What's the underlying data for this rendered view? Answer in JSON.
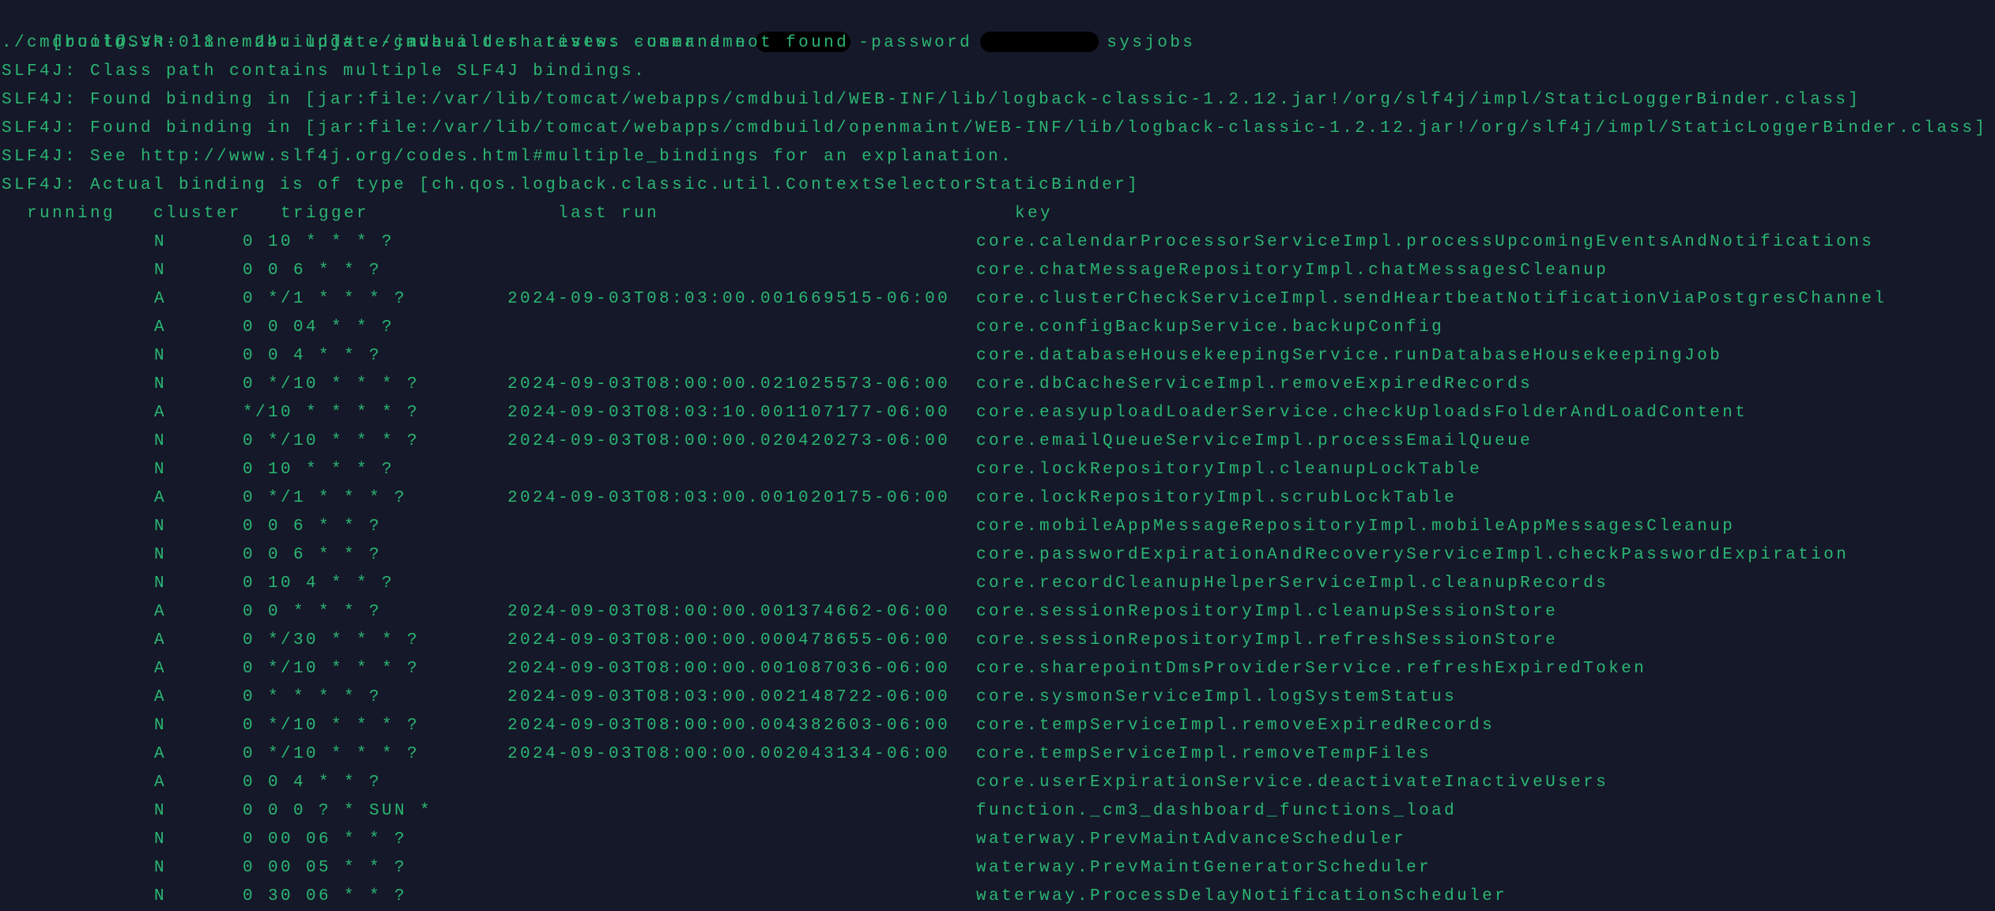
{
  "terminal": {
    "theme": {
      "background": "#151829",
      "foreground": "#2bb673"
    },
    "command": {
      "prompt": "[root@SVR-018 cmdbuild]#",
      "command_start": "./cmdbuild.sh restws -username",
      "username_redacted": true,
      "password_flag": "-password",
      "password_redacted": true,
      "argument": "sysjobs"
    },
    "output_lines": [
      "./cmdbuild.sh: line 24: update-java-alternatives: command not found",
      "SLF4J: Class path contains multiple SLF4J bindings.",
      "SLF4J: Found binding in [jar:file:/var/lib/tomcat/webapps/cmdbuild/WEB-INF/lib/logback-classic-1.2.12.jar!/org/slf4j/impl/StaticLoggerBinder.class]",
      "SLF4J: Found binding in [jar:file:/var/lib/tomcat/webapps/cmdbuild/openmaint/WEB-INF/lib/logback-classic-1.2.12.jar!/org/slf4j/impl/StaticLoggerBinder.class]",
      "SLF4J: See http://www.slf4j.org/codes.html#multiple_bindings for an explanation.",
      "SLF4J: Actual binding is of type [ch.qos.logback.classic.util.ContextSelectorStaticBinder]"
    ],
    "jobs_table": {
      "headers": {
        "running": "running",
        "cluster": "cluster",
        "trigger": "trigger",
        "last_run": "last run",
        "key": "key"
      },
      "rows": [
        {
          "running": "",
          "cluster": "N",
          "trigger": "0 10 * * * ?",
          "last_run": "",
          "key": "core.calendarProcessorServiceImpl.processUpcomingEventsAndNotifications"
        },
        {
          "running": "",
          "cluster": "N",
          "trigger": "0 0 6 * * ?",
          "last_run": "",
          "key": "core.chatMessageRepositoryImpl.chatMessagesCleanup"
        },
        {
          "running": "",
          "cluster": "A",
          "trigger": "0 */1 * * * ?",
          "last_run": "2024-09-03T08:03:00.001669515-06:00",
          "key": "core.clusterCheckServiceImpl.sendHeartbeatNotificationViaPostgresChannel"
        },
        {
          "running": "",
          "cluster": "A",
          "trigger": "0 0 04 * * ?",
          "last_run": "",
          "key": "core.configBackupService.backupConfig"
        },
        {
          "running": "",
          "cluster": "N",
          "trigger": "0 0 4 * * ?",
          "last_run": "",
          "key": "core.databaseHousekeepingService.runDatabaseHousekeepingJob"
        },
        {
          "running": "",
          "cluster": "N",
          "trigger": "0 */10 * * * ?",
          "last_run": "2024-09-03T08:00:00.021025573-06:00",
          "key": "core.dbCacheServiceImpl.removeExpiredRecords"
        },
        {
          "running": "",
          "cluster": "A",
          "trigger": "*/10 * * * * ?",
          "last_run": "2024-09-03T08:03:10.001107177-06:00",
          "key": "core.easyuploadLoaderService.checkUploadsFolderAndLoadContent"
        },
        {
          "running": "",
          "cluster": "N",
          "trigger": "0 */10 * * * ?",
          "last_run": "2024-09-03T08:00:00.020420273-06:00",
          "key": "core.emailQueueServiceImpl.processEmailQueue"
        },
        {
          "running": "",
          "cluster": "N",
          "trigger": "0 10 * * * ?",
          "last_run": "",
          "key": "core.lockRepositoryImpl.cleanupLockTable"
        },
        {
          "running": "",
          "cluster": "A",
          "trigger": "0 */1 * * * ?",
          "last_run": "2024-09-03T08:03:00.001020175-06:00",
          "key": "core.lockRepositoryImpl.scrubLockTable"
        },
        {
          "running": "",
          "cluster": "N",
          "trigger": "0 0 6 * * ?",
          "last_run": "",
          "key": "core.mobileAppMessageRepositoryImpl.mobileAppMessagesCleanup"
        },
        {
          "running": "",
          "cluster": "N",
          "trigger": "0 0 6 * * ?",
          "last_run": "",
          "key": "core.passwordExpirationAndRecoveryServiceImpl.checkPasswordExpiration"
        },
        {
          "running": "",
          "cluster": "N",
          "trigger": "0 10 4 * * ?",
          "last_run": "",
          "key": "core.recordCleanupHelperServiceImpl.cleanupRecords"
        },
        {
          "running": "",
          "cluster": "A",
          "trigger": "0 0 * * * ?",
          "last_run": "2024-09-03T08:00:00.001374662-06:00",
          "key": "core.sessionRepositoryImpl.cleanupSessionStore"
        },
        {
          "running": "",
          "cluster": "A",
          "trigger": "0 */30 * * * ?",
          "last_run": "2024-09-03T08:00:00.000478655-06:00",
          "key": "core.sessionRepositoryImpl.refreshSessionStore"
        },
        {
          "running": "",
          "cluster": "A",
          "trigger": "0 */10 * * * ?",
          "last_run": "2024-09-03T08:00:00.001087036-06:00",
          "key": "core.sharepointDmsProviderService.refreshExpiredToken"
        },
        {
          "running": "",
          "cluster": "A",
          "trigger": "0 * * * * ?",
          "last_run": "2024-09-03T08:03:00.002148722-06:00",
          "key": "core.sysmonServiceImpl.logSystemStatus"
        },
        {
          "running": "",
          "cluster": "N",
          "trigger": "0 */10 * * * ?",
          "last_run": "2024-09-03T08:00:00.004382603-06:00",
          "key": "core.tempServiceImpl.removeExpiredRecords"
        },
        {
          "running": "",
          "cluster": "A",
          "trigger": "0 */10 * * * ?",
          "last_run": "2024-09-03T08:00:00.002043134-06:00",
          "key": "core.tempServiceImpl.removeTempFiles"
        },
        {
          "running": "",
          "cluster": "A",
          "trigger": "0 0 4 * * ?",
          "last_run": "",
          "key": "core.userExpirationService.deactivateInactiveUsers"
        },
        {
          "running": "",
          "cluster": "N",
          "trigger": "0 0 0 ? * SUN *",
          "last_run": "",
          "key": "function._cm3_dashboard_functions_load"
        },
        {
          "running": "",
          "cluster": "N",
          "trigger": "0 00 06 * * ?",
          "last_run": "",
          "key": "waterway.PrevMaintAdvanceScheduler"
        },
        {
          "running": "",
          "cluster": "N",
          "trigger": "0 00 05 * * ?",
          "last_run": "",
          "key": "waterway.PrevMaintGeneratorScheduler"
        },
        {
          "running": "",
          "cluster": "N",
          "trigger": "0 30 06 * * ?",
          "last_run": "",
          "key": "waterway.ProcessDelayNotificationScheduler"
        }
      ]
    }
  }
}
